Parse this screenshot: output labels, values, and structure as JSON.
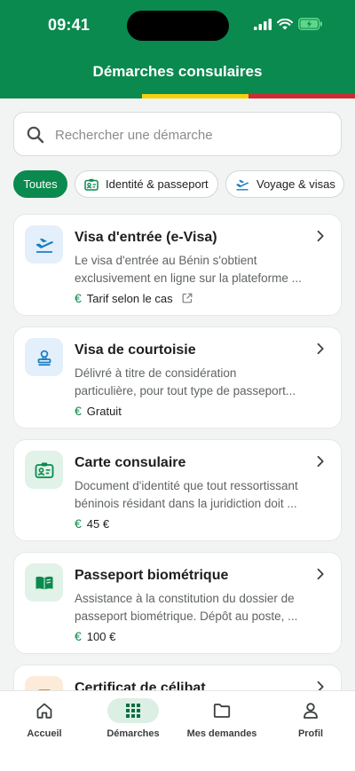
{
  "status_bar": {
    "time": "09:41"
  },
  "header": {
    "title": "Démarches consulaires"
  },
  "search": {
    "placeholder": "Rechercher une démarche"
  },
  "chips": [
    {
      "label": "Toutes",
      "active": true
    },
    {
      "label": "Identité & passeport",
      "icon": "id-card-icon"
    },
    {
      "label": "Voyage & visas",
      "icon": "plane-departure-icon"
    }
  ],
  "cards": [
    {
      "title": "Visa d'entrée (e-Visa)",
      "desc_line1": "Le visa d'entrée au Bénin s'obtient",
      "desc_line2": "exclusivement en ligne sur la plateforme ...",
      "price": "Tarif selon le cas",
      "currency": "€",
      "icon": "plane-departure-icon",
      "badge_color": "#e3f0fb"
    },
    {
      "title": "Visa de courtoisie",
      "desc_line1": "Délivré à titre de considération",
      "desc_line2": "particulière, pour tout type de passeport...",
      "price": "Gratuit",
      "currency": "€",
      "icon": "stamp-icon",
      "badge_color": "#e3f0fb"
    },
    {
      "title": "Carte consulaire",
      "desc_line1": "Document d'identité que tout ressortissant",
      "desc_line2": "béninois résidant dans la juridiction doit ...",
      "price": "45 €",
      "currency": "€",
      "icon": "id-card-icon",
      "badge_color": "#e1f2e8"
    },
    {
      "title": "Passeport biométrique",
      "desc_line1": "Assistance à la constitution du dossier de",
      "desc_line2": "passeport biométrique. Dépôt au poste, ...",
      "price": "100 €",
      "currency": "€",
      "icon": "book-icon",
      "badge_color": "#e1f2e8"
    },
    {
      "title": "Certificat de célibat",
      "icon": "ring-icon",
      "badge_color": "#fdebd9"
    }
  ],
  "tabbar": {
    "items": [
      {
        "label": "Accueil",
        "icon": "home-icon"
      },
      {
        "label": "Démarches",
        "icon": "grid-icon",
        "active": true
      },
      {
        "label": "Mes demandes",
        "icon": "folder-icon"
      },
      {
        "label": "Profil",
        "icon": "user-icon"
      }
    ]
  },
  "colors": {
    "brand_green": "#0a8a4e",
    "flag_yellow": "#f5d10b",
    "flag_red": "#d02b34"
  }
}
